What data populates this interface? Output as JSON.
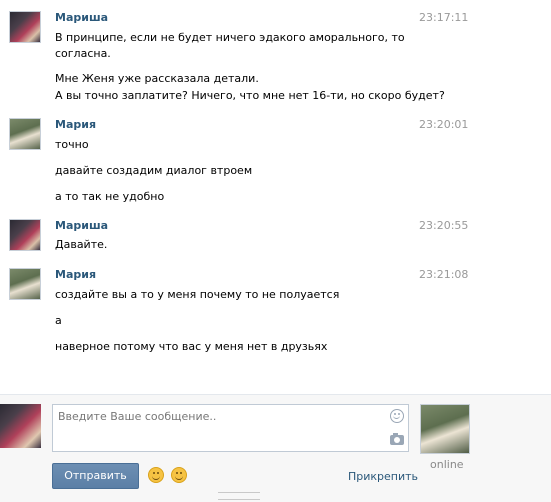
{
  "messages": [
    {
      "author": "Мариша",
      "time": "23:17:11",
      "lines": [
        "В принципе, если не будет ничего эдакого аморального, то",
        "согласна.",
        "Мне Женя уже рассказала детали.",
        "А вы точно заплатите? Ничего, что мне нет 16-ти, но скоро будет?"
      ]
    },
    {
      "author": "Мария",
      "time": "23:20:01",
      "lines": [
        "точно",
        "давайте создадим диалог втроем",
        "а то так не удобно"
      ]
    },
    {
      "author": "Мариша",
      "time": "23:20:55",
      "lines": [
        "Давайте."
      ]
    },
    {
      "author": "Мария",
      "time": "23:21:08",
      "lines": [
        "создайте вы а то у меня почему то не полуается",
        "а",
        "наверное потому что вас у меня нет в друзьях"
      ]
    }
  ],
  "compose": {
    "placeholder": "Введите Ваше сообщение..",
    "send_label": "Отправить",
    "attach_label": "Прикрепить",
    "online_label": "online"
  },
  "icons": {
    "emoji_1": "smile-emoji-icon",
    "emoji_2": "kiss-emoji-icon",
    "input_smile": "smile-icon",
    "input_camera": "camera-icon"
  },
  "colors": {
    "author": "#2b587a",
    "time": "#999999",
    "button": "#5b7fa6",
    "link": "#2b587a"
  }
}
